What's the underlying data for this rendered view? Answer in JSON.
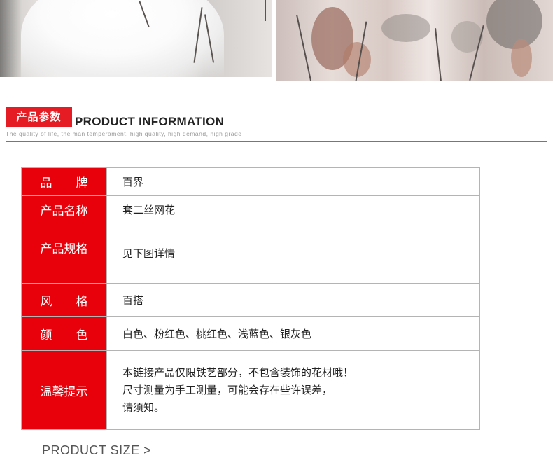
{
  "section": {
    "badge": "产品参数",
    "title": "PRODUCT INFORMATION",
    "subtitle": "The quality of life, the man temperament, high quality, high demand, high grade"
  },
  "table": {
    "rows": [
      {
        "label": "品牌",
        "value": "百界"
      },
      {
        "label": "产品名称",
        "value": "套二丝网花"
      },
      {
        "label": "产品规格",
        "value": "见下图详情"
      },
      {
        "label": "风格",
        "value": "百搭"
      },
      {
        "label": "颜色",
        "value": "白色、粉红色、桃红色、浅蓝色、银灰色"
      },
      {
        "label": "温馨提示",
        "lines": [
          "本链接产品仅限铁艺部分，不包含装饰的花材哦！",
          "尺寸测量为手工测量，可能会存在些许误差，",
          "请须知。"
        ]
      }
    ]
  },
  "next_section": {
    "title": "PRODUCT SIZE >"
  },
  "colors": {
    "accent": "#e8000b",
    "rule": "#e64a3b",
    "border": "#b4b4b4"
  }
}
